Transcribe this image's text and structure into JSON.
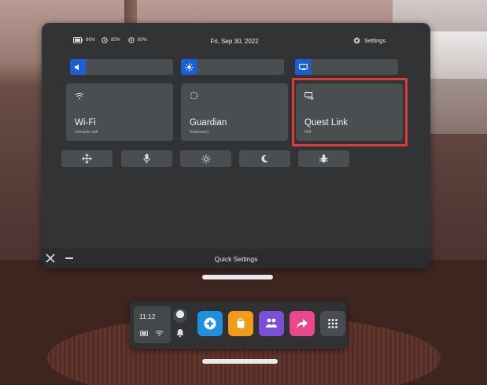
{
  "status": {
    "headset_battery": "86%",
    "left_controller_battery": "80%",
    "right_controller_battery": "80%",
    "date": "Fri, Sep 30, 2022",
    "settings_label": "Settings"
  },
  "toggles": [
    {
      "icon": "speaker-icon"
    },
    {
      "icon": "brightness-icon"
    },
    {
      "icon": "cast-icon"
    }
  ],
  "tiles": [
    {
      "title": "Wi-Fi",
      "subtitle": "volcanic-wifi",
      "icon": "wifi-icon"
    },
    {
      "title": "Guardian",
      "subtitle": "Stationary",
      "icon": "guardian-icon"
    },
    {
      "title": "Quest Link",
      "subtitle": "Rift",
      "icon": "quest-link-icon"
    }
  ],
  "mini_buttons": [
    {
      "icon": "move-icon"
    },
    {
      "icon": "microphone-icon"
    },
    {
      "icon": "brightness-icon"
    },
    {
      "icon": "night-mode-icon"
    },
    {
      "icon": "bug-icon"
    }
  ],
  "footer": {
    "title": "Quick Settings"
  },
  "dock": {
    "time": "11:12",
    "apps": [
      "explore-icon",
      "store-icon",
      "people-icon",
      "share-icon",
      "app-library-icon"
    ]
  },
  "colors": {
    "accent": "#1a5fd6",
    "highlight": "#e03a3a",
    "panel": "#313335",
    "tile": "#4b4e51"
  }
}
